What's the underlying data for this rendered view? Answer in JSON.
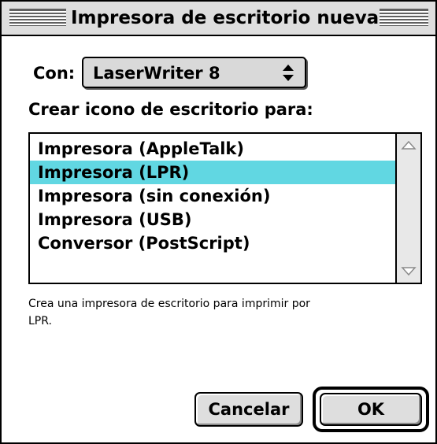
{
  "window": {
    "title": "Impresora de escritorio nueva"
  },
  "connection": {
    "label": "Con:",
    "selected": "LaserWriter 8"
  },
  "list": {
    "heading": "Crear icono de escritorio para:",
    "items": [
      {
        "label": "Impresora (AppleTalk)",
        "selected": false
      },
      {
        "label": "Impresora (LPR)",
        "selected": true
      },
      {
        "label": "Impresora (sin conexión)",
        "selected": false
      },
      {
        "label": "Impresora (USB)",
        "selected": false
      },
      {
        "label": "Conversor (PostScript)",
        "selected": false
      }
    ]
  },
  "description": {
    "line1": "Crea una impresora de escritorio para imprimir por",
    "line2": "LPR."
  },
  "buttons": {
    "cancel_label": "Cancelar",
    "ok_label": "OK"
  },
  "colors": {
    "selection": "#61d7e2",
    "chrome": "#dedede"
  },
  "icons": {
    "popup": "up-down-arrows-icon",
    "scroll_up": "scroll-up-arrow-icon",
    "scroll_down": "scroll-down-arrow-icon"
  }
}
